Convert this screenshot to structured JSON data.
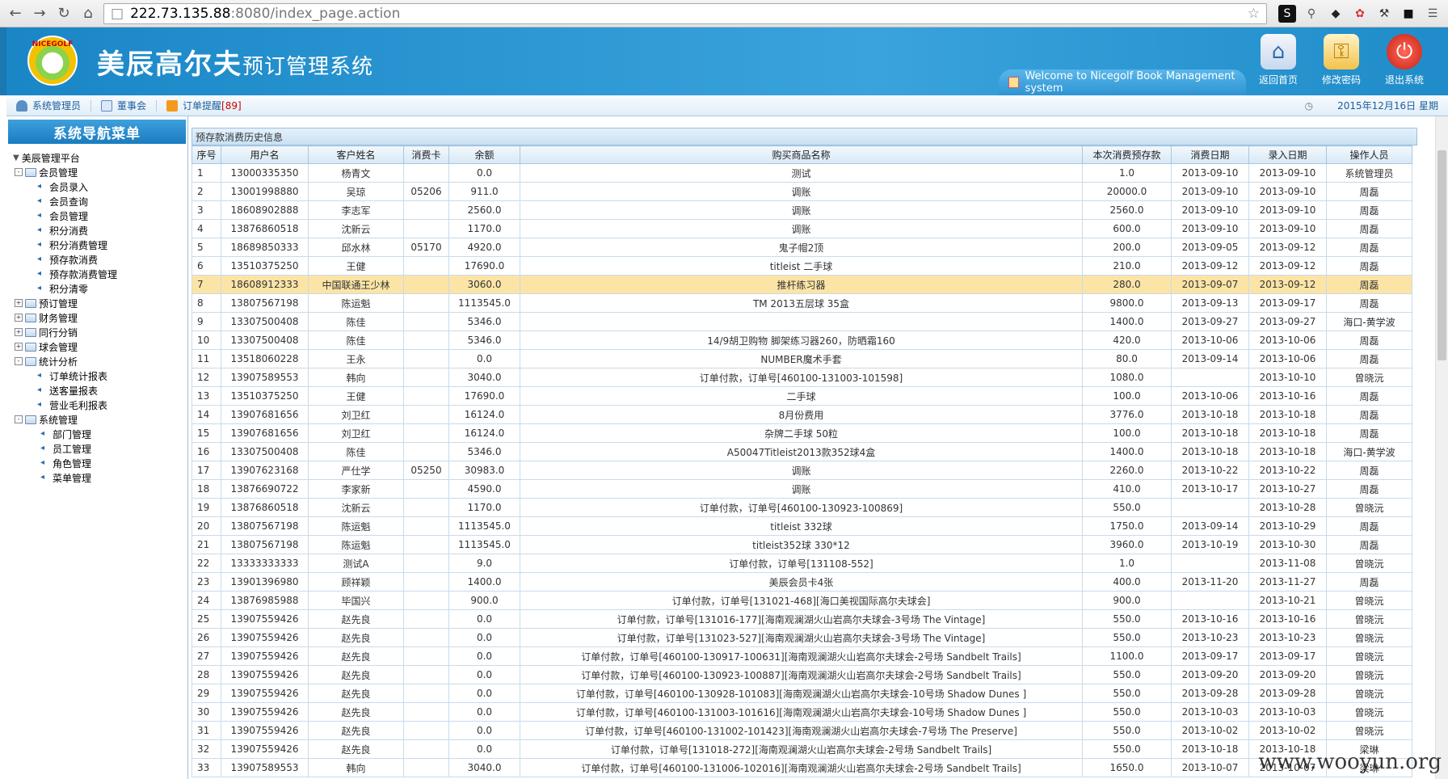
{
  "browser": {
    "url_host": "222.73.135.88",
    "url_rest": ":8080/index_page.action"
  },
  "banner": {
    "logo_text": "NICEGOLF",
    "brand_main": "美辰高尔夫",
    "brand_sub": "预订管理系统",
    "welcome": "Welcome to Nicegolf Book Management system",
    "actions": [
      "返回首页",
      "修改密码",
      "退出系统"
    ]
  },
  "statusbar": {
    "user": "系统管理员",
    "role": "董事会",
    "remind_label": "订单提醒",
    "remind_count": "[89]",
    "date": "2015年12月16日",
    "weekday": "星期"
  },
  "sidebar": {
    "title": "系统导航菜单",
    "root": "美辰管理平台",
    "groups": [
      {
        "label": "会员管理",
        "open": true,
        "items": [
          "会员录入",
          "会员查询",
          "会员管理",
          "积分消费",
          "积分消费管理",
          "预存款消费",
          "预存款消费管理",
          "积分清零"
        ]
      },
      {
        "label": "预订管理",
        "open": false,
        "items": []
      },
      {
        "label": "财务管理",
        "open": false,
        "items": []
      },
      {
        "label": "同行分销",
        "open": false,
        "items": []
      },
      {
        "label": "球会管理",
        "open": false,
        "items": []
      },
      {
        "label": "统计分析",
        "open": true,
        "items": [
          "订单统计报表",
          "送客量报表",
          "营业毛利报表"
        ]
      },
      {
        "label": "系统管理",
        "open": true,
        "items": [
          "部门管理",
          "员工管理",
          "角色管理",
          "菜单管理"
        ]
      }
    ]
  },
  "content": {
    "title": "预存款消费历史信息",
    "columns": [
      "序号",
      "用户名",
      "客户姓名",
      "消费卡",
      "余额",
      "购买商品名称",
      "本次消费预存款",
      "消费日期",
      "录入日期",
      "操作人员"
    ],
    "rows": [
      [
        "1",
        "13000335350",
        "杨青文",
        "",
        "0.0",
        "测试",
        "1.0",
        "2013-09-10",
        "2013-09-10",
        "系统管理员"
      ],
      [
        "2",
        "13001998880",
        "吴琼",
        "05206",
        "911.0",
        "调账",
        "20000.0",
        "2013-09-10",
        "2013-09-10",
        "周磊"
      ],
      [
        "3",
        "18608902888",
        "李志军",
        "",
        "2560.0",
        "调账",
        "2560.0",
        "2013-09-10",
        "2013-09-10",
        "周磊"
      ],
      [
        "4",
        "13876860518",
        "沈新云",
        "",
        "1170.0",
        "调账",
        "600.0",
        "2013-09-10",
        "2013-09-10",
        "周磊"
      ],
      [
        "5",
        "18689850333",
        "邱水林",
        "05170",
        "4920.0",
        "鬼子帽2顶",
        "200.0",
        "2013-09-05",
        "2013-09-12",
        "周磊"
      ],
      [
        "6",
        "13510375250",
        "王健",
        "",
        "17690.0",
        "titleist 二手球",
        "210.0",
        "2013-09-12",
        "2013-09-12",
        "周磊"
      ],
      [
        "7",
        "18608912333",
        "中国联通王少林",
        "",
        "3060.0",
        "推杆练习器",
        "280.0",
        "2013-09-07",
        "2013-09-12",
        "周磊"
      ],
      [
        "8",
        "13807567198",
        "陈运魁",
        "",
        "1113545.0",
        "TM 2013五层球 35盒",
        "9800.0",
        "2013-09-13",
        "2013-09-17",
        "周磊"
      ],
      [
        "9",
        "13307500408",
        "陈佳",
        "",
        "5346.0",
        "",
        "1400.0",
        "2013-09-27",
        "2013-09-27",
        "海口-黄学波"
      ],
      [
        "10",
        "13307500408",
        "陈佳",
        "",
        "5346.0",
        "14/9胡卫购物 脚架练习器260，防晒霜160",
        "420.0",
        "2013-10-06",
        "2013-10-06",
        "周磊"
      ],
      [
        "11",
        "13518060228",
        "王永",
        "",
        "0.0",
        "NUMBER魔术手套",
        "80.0",
        "2013-09-14",
        "2013-10-06",
        "周磊"
      ],
      [
        "12",
        "13907589553",
        "韩向",
        "",
        "3040.0",
        "订单付款，订单号[460100-131003-101598]",
        "1080.0",
        "",
        "2013-10-10",
        "曾晓沅"
      ],
      [
        "13",
        "13510375250",
        "王健",
        "",
        "17690.0",
        "二手球",
        "100.0",
        "2013-10-06",
        "2013-10-16",
        "周磊"
      ],
      [
        "14",
        "13907681656",
        "刘卫红",
        "",
        "16124.0",
        "8月份费用",
        "3776.0",
        "2013-10-18",
        "2013-10-18",
        "周磊"
      ],
      [
        "15",
        "13907681656",
        "刘卫红",
        "",
        "16124.0",
        "杂牌二手球 50粒",
        "100.0",
        "2013-10-18",
        "2013-10-18",
        "周磊"
      ],
      [
        "16",
        "13307500408",
        "陈佳",
        "",
        "5346.0",
        "A50047Titleist2013款352球4盒",
        "1400.0",
        "2013-10-18",
        "2013-10-18",
        "海口-黄学波"
      ],
      [
        "17",
        "13907623168",
        "严仕学",
        "05250",
        "30983.0",
        "调账",
        "2260.0",
        "2013-10-22",
        "2013-10-22",
        "周磊"
      ],
      [
        "18",
        "13876690722",
        "李家新",
        "",
        "4590.0",
        "调账",
        "410.0",
        "2013-10-17",
        "2013-10-27",
        "周磊"
      ],
      [
        "19",
        "13876860518",
        "沈新云",
        "",
        "1170.0",
        "订单付款，订单号[460100-130923-100869]",
        "550.0",
        "",
        "2013-10-28",
        "曾晓沅"
      ],
      [
        "20",
        "13807567198",
        "陈运魁",
        "",
        "1113545.0",
        "titleist 332球",
        "1750.0",
        "2013-09-14",
        "2013-10-29",
        "周磊"
      ],
      [
        "21",
        "13807567198",
        "陈运魁",
        "",
        "1113545.0",
        "titleist352球 330*12",
        "3960.0",
        "2013-10-19",
        "2013-10-30",
        "周磊"
      ],
      [
        "22",
        "13333333333",
        "测试A",
        "",
        "9.0",
        "订单付款，订单号[131108-552]",
        "1.0",
        "",
        "2013-11-08",
        "曾晓沅"
      ],
      [
        "23",
        "13901396980",
        "顾祥颖",
        "",
        "1400.0",
        "美辰会员卡4张",
        "400.0",
        "2013-11-20",
        "2013-11-27",
        "周磊"
      ],
      [
        "24",
        "13876985988",
        "毕国兴",
        "",
        "900.0",
        "订单付款，订单号[131021-468][海口美视国际高尔夫球会]",
        "900.0",
        "",
        "2013-10-21",
        "曾晓沅"
      ],
      [
        "25",
        "13907559426",
        "赵先良",
        "",
        "0.0",
        "订单付款，订单号[131016-177][海南观澜湖火山岩高尔夫球会-3号场 The Vintage]",
        "550.0",
        "2013-10-16",
        "2013-10-16",
        "曾晓沅"
      ],
      [
        "26",
        "13907559426",
        "赵先良",
        "",
        "0.0",
        "订单付款，订单号[131023-527][海南观澜湖火山岩高尔夫球会-3号场 The Vintage]",
        "550.0",
        "2013-10-23",
        "2013-10-23",
        "曾晓沅"
      ],
      [
        "27",
        "13907559426",
        "赵先良",
        "",
        "0.0",
        "订单付款，订单号[460100-130917-100631][海南观澜湖火山岩高尔夫球会-2号场 Sandbelt Trails]",
        "1100.0",
        "2013-09-17",
        "2013-09-17",
        "曾晓沅"
      ],
      [
        "28",
        "13907559426",
        "赵先良",
        "",
        "0.0",
        "订单付款，订单号[460100-130923-100887][海南观澜湖火山岩高尔夫球会-2号场 Sandbelt Trails]",
        "550.0",
        "2013-09-20",
        "2013-09-20",
        "曾晓沅"
      ],
      [
        "29",
        "13907559426",
        "赵先良",
        "",
        "0.0",
        "订单付款，订单号[460100-130928-101083][海南观澜湖火山岩高尔夫球会-10号场 Shadow Dunes ]",
        "550.0",
        "2013-09-28",
        "2013-09-28",
        "曾晓沅"
      ],
      [
        "30",
        "13907559426",
        "赵先良",
        "",
        "0.0",
        "订单付款，订单号[460100-131003-101616][海南观澜湖火山岩高尔夫球会-10号场 Shadow Dunes ]",
        "550.0",
        "2013-10-03",
        "2013-10-03",
        "曾晓沅"
      ],
      [
        "31",
        "13907559426",
        "赵先良",
        "",
        "0.0",
        "订单付款，订单号[460100-131002-101423][海南观澜湖火山岩高尔夫球会-7号场 The Preserve]",
        "550.0",
        "2013-10-02",
        "2013-10-02",
        "曾晓沅"
      ],
      [
        "32",
        "13907559426",
        "赵先良",
        "",
        "0.0",
        "订单付款，订单号[131018-272][海南观澜湖火山岩高尔夫球会-2号场 Sandbelt Trails]",
        "550.0",
        "2013-10-18",
        "2013-10-18",
        "梁琳"
      ],
      [
        "33",
        "13907589553",
        "韩向",
        "",
        "3040.0",
        "订单付款，订单号[460100-131006-102016][海南观澜湖火山岩高尔夫球会-2号场 Sandbelt Trails]",
        "1650.0",
        "2013-10-07",
        "2013-10-07",
        "梁琳"
      ]
    ],
    "highlighted_row": "7"
  },
  "watermark": "www.wooyun.org",
  "colors": {
    "banner": "#2a96d6",
    "highlight": "#fbe4a6"
  },
  "icons": [
    "back-icon",
    "forward-icon",
    "reload-icon",
    "home-icon",
    "page-icon",
    "star-icon",
    "home-action-icon",
    "key-icon",
    "power-icon",
    "user-icon",
    "card-icon",
    "rss-icon",
    "clock-icon"
  ]
}
